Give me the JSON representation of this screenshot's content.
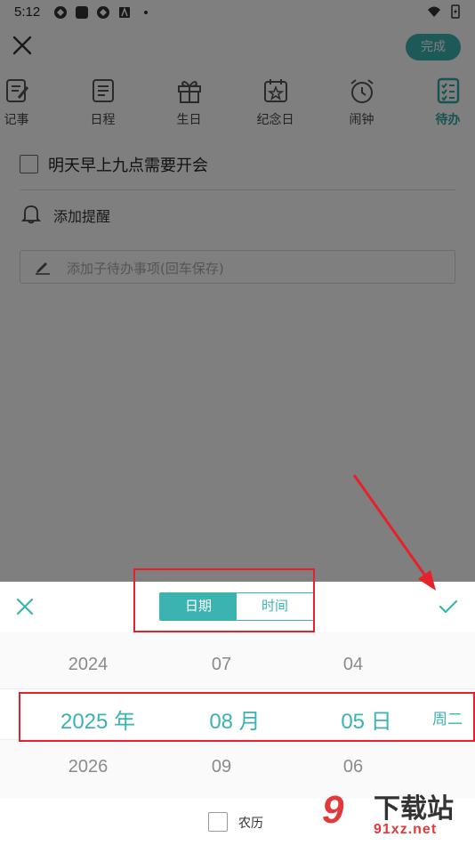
{
  "status_bar": {
    "time": "5:12"
  },
  "header": {
    "done_label": "完成"
  },
  "categories": [
    {
      "label": "记事",
      "icon": "note-icon"
    },
    {
      "label": "日程",
      "icon": "schedule-icon"
    },
    {
      "label": "生日",
      "icon": "gift-icon"
    },
    {
      "label": "纪念日",
      "icon": "anniversary-icon"
    },
    {
      "label": "闹钟",
      "icon": "alarm-icon"
    },
    {
      "label": "待办",
      "icon": "todo-list-icon",
      "active": true
    }
  ],
  "todo": {
    "title": "明天早上九点需要开会",
    "reminder_label": "添加提醒",
    "subtask_placeholder": "添加子待办事项(回车保存)"
  },
  "picker": {
    "tabs": [
      {
        "label": "日期",
        "selected": true
      },
      {
        "label": "时间",
        "selected": false
      }
    ],
    "years": [
      "2024",
      "2025 年",
      "2026"
    ],
    "months": [
      "07",
      "08 月",
      "09"
    ],
    "days": [
      "04",
      "05 日",
      "06"
    ],
    "weekday": "周二",
    "lunar_label": "农历",
    "lunar_checked": false
  },
  "colors": {
    "accent": "#3bb3b0",
    "annotation": "#e8202a"
  },
  "watermark": {
    "number": "9",
    "name": "下载站",
    "url": "91xz.net"
  }
}
